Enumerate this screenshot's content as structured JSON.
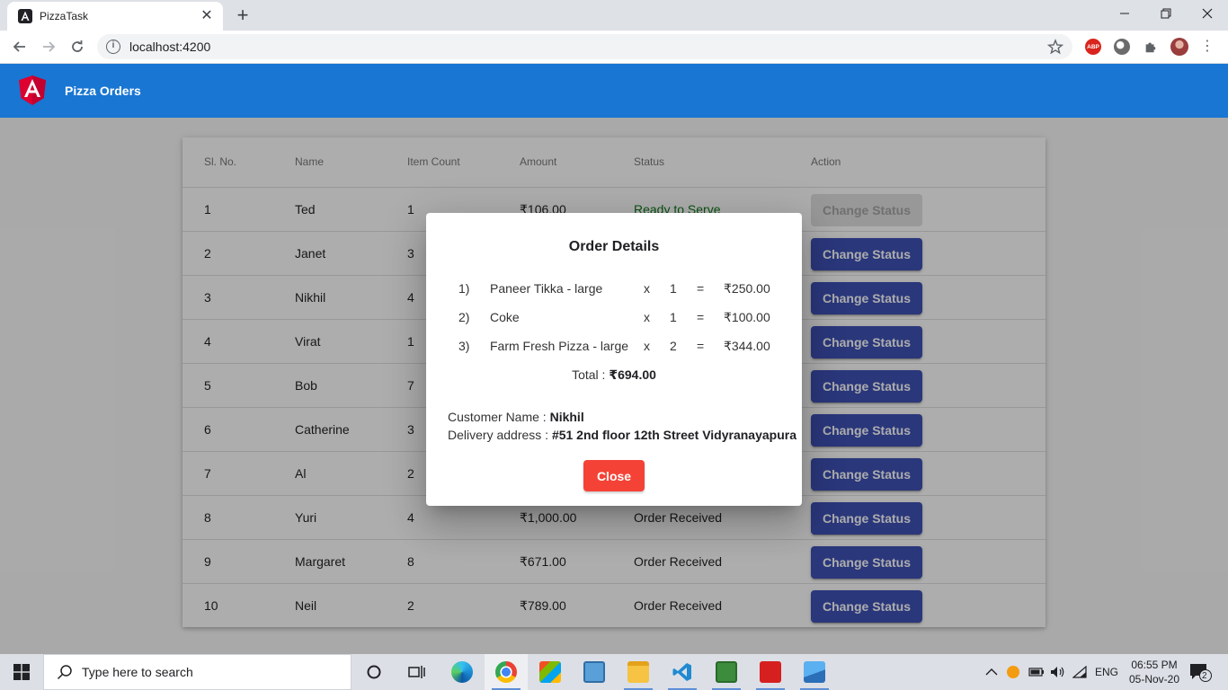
{
  "browser": {
    "tab_title": "PizzaTask",
    "url": "localhost:4200",
    "ext_abp": "ABP"
  },
  "app": {
    "title": "Pizza Orders"
  },
  "table": {
    "headers": [
      "Sl. No.",
      "Name",
      "Item Count",
      "Amount",
      "Status",
      "Action"
    ],
    "rows": [
      {
        "sl": "1",
        "name": "Ted",
        "count": "1",
        "amount": "₹106.00",
        "status": "Ready to Serve",
        "action": "Change Status",
        "disabled": true
      },
      {
        "sl": "2",
        "name": "Janet",
        "count": "3",
        "amount": "",
        "status": "",
        "action": "Change Status"
      },
      {
        "sl": "3",
        "name": "Nikhil",
        "count": "4",
        "amount": "",
        "status": "",
        "action": "Change Status"
      },
      {
        "sl": "4",
        "name": "Virat",
        "count": "1",
        "amount": "",
        "status": "",
        "action": "Change Status"
      },
      {
        "sl": "5",
        "name": "Bob",
        "count": "7",
        "amount": "",
        "status": "",
        "action": "Change Status"
      },
      {
        "sl": "6",
        "name": "Catherine",
        "count": "3",
        "amount": "",
        "status": "",
        "action": "Change Status"
      },
      {
        "sl": "7",
        "name": "Al",
        "count": "2",
        "amount": "",
        "status": "",
        "action": "Change Status"
      },
      {
        "sl": "8",
        "name": "Yuri",
        "count": "4",
        "amount": "₹1,000.00",
        "status": "Order Received",
        "action": "Change Status"
      },
      {
        "sl": "9",
        "name": "Margaret",
        "count": "8",
        "amount": "₹671.00",
        "status": "Order Received",
        "action": "Change Status"
      },
      {
        "sl": "10",
        "name": "Neil",
        "count": "2",
        "amount": "₹789.00",
        "status": "Order Received",
        "action": "Change Status"
      }
    ]
  },
  "dialog": {
    "title": "Order Details",
    "items": [
      {
        "idx": "1)",
        "name": "Paneer Tikka - large",
        "x": "x",
        "qty": "1",
        "eq": "=",
        "price": "₹250.00"
      },
      {
        "idx": "2)",
        "name": "Coke",
        "x": "x",
        "qty": "1",
        "eq": "=",
        "price": "₹100.00"
      },
      {
        "idx": "3)",
        "name": "Farm Fresh Pizza - large",
        "x": "x",
        "qty": "2",
        "eq": "=",
        "price": "₹344.00"
      }
    ],
    "total_label": "Total : ",
    "total_value": "₹694.00",
    "customer_label": "Customer Name : ",
    "customer_value": "Nikhil",
    "address_label": "Delivery address : ",
    "address_value": "#51 2nd floor 12th Street Vidyranayapura",
    "close_label": "Close"
  },
  "taskbar": {
    "search_placeholder": "Type here to search",
    "lang": "ENG",
    "time": "06:55 PM",
    "date": "05-Nov-20",
    "notification_count": "2"
  },
  "colors": {
    "header": "#1976d2",
    "primary_button": "#3f51b5",
    "close_button": "#f44336",
    "ready_status": "#0f7a1a"
  }
}
